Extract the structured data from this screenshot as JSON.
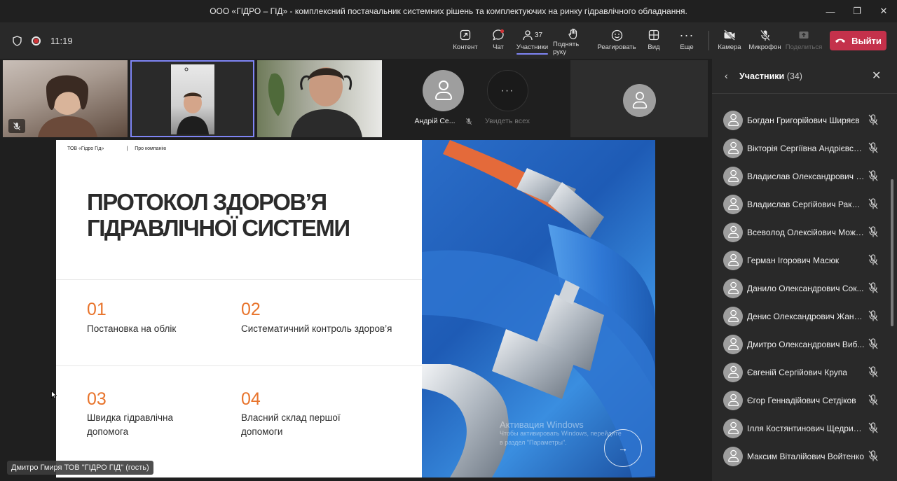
{
  "window": {
    "title": "ООО «ГІДРО – ГІД» - комплексний постачальник системних рішень та комплектуючих на ринку гідравлічного обладнання."
  },
  "toolbar": {
    "time": "11:19",
    "items": {
      "content": "Контент",
      "chat": "Чат",
      "participants": "Участники",
      "participants_count": "37",
      "raise_hand": "Поднять руку",
      "react": "Реагировать",
      "view": "Вид",
      "more": "Еще",
      "camera": "Камера",
      "mic": "Микрофон",
      "share": "Поделиться"
    },
    "leave_label": "Выйти"
  },
  "stage": {
    "avatar_tile_name": "Андрій Се...",
    "see_all_label": "Увидеть всех",
    "presenter_tag": "Дмитро Гмиря ТОВ \"ГІДРО ГІД\" (гость)"
  },
  "slide": {
    "header_company": "ТОВ «Гідро Гід»",
    "header_divider": "|",
    "header_section": "Про компанію",
    "title_line1": "ПРОТОКОЛ ЗДОРОВ’Я",
    "title_line2": "ГІДРАВЛІЧНОЇ СИСТЕМИ",
    "items": [
      {
        "num": "01",
        "text": "Постановка на облік"
      },
      {
        "num": "02",
        "text": "Систематичний контроль здоров’я"
      },
      {
        "num": "03",
        "text": "Швидка гідравлічна допомога"
      },
      {
        "num": "04",
        "text": "Власний склад першої допомоги"
      }
    ],
    "next_arrow": "→",
    "accent_color": "#e8742c"
  },
  "watermark": {
    "line1": "Активация Windows",
    "line2": "Чтобы активировать Windows, перейдите",
    "line3": "в раздел \"Параметры\"."
  },
  "panel": {
    "title": "Участники",
    "count": "(34)",
    "participants": [
      "Богдан Григорійович Ширяєв",
      "Вікторія Сергіївна Андрієвська",
      "Владислав Олександрович Б...",
      "Владислав Сергійович Ракит...",
      "Всеволод Олексійович Може...",
      "Герман Ігорович Масюк",
      "Данило Олександрович Сок...",
      "Денис Олександрович Жанд...",
      "Дмитро Олександрович Виб...",
      "Євгеній Сергійович Крупа",
      "Єгор Геннадійович Сетдіков",
      "Ілля Костянтинович Щедрин...",
      "Максим Віталійович Войтенко"
    ]
  }
}
